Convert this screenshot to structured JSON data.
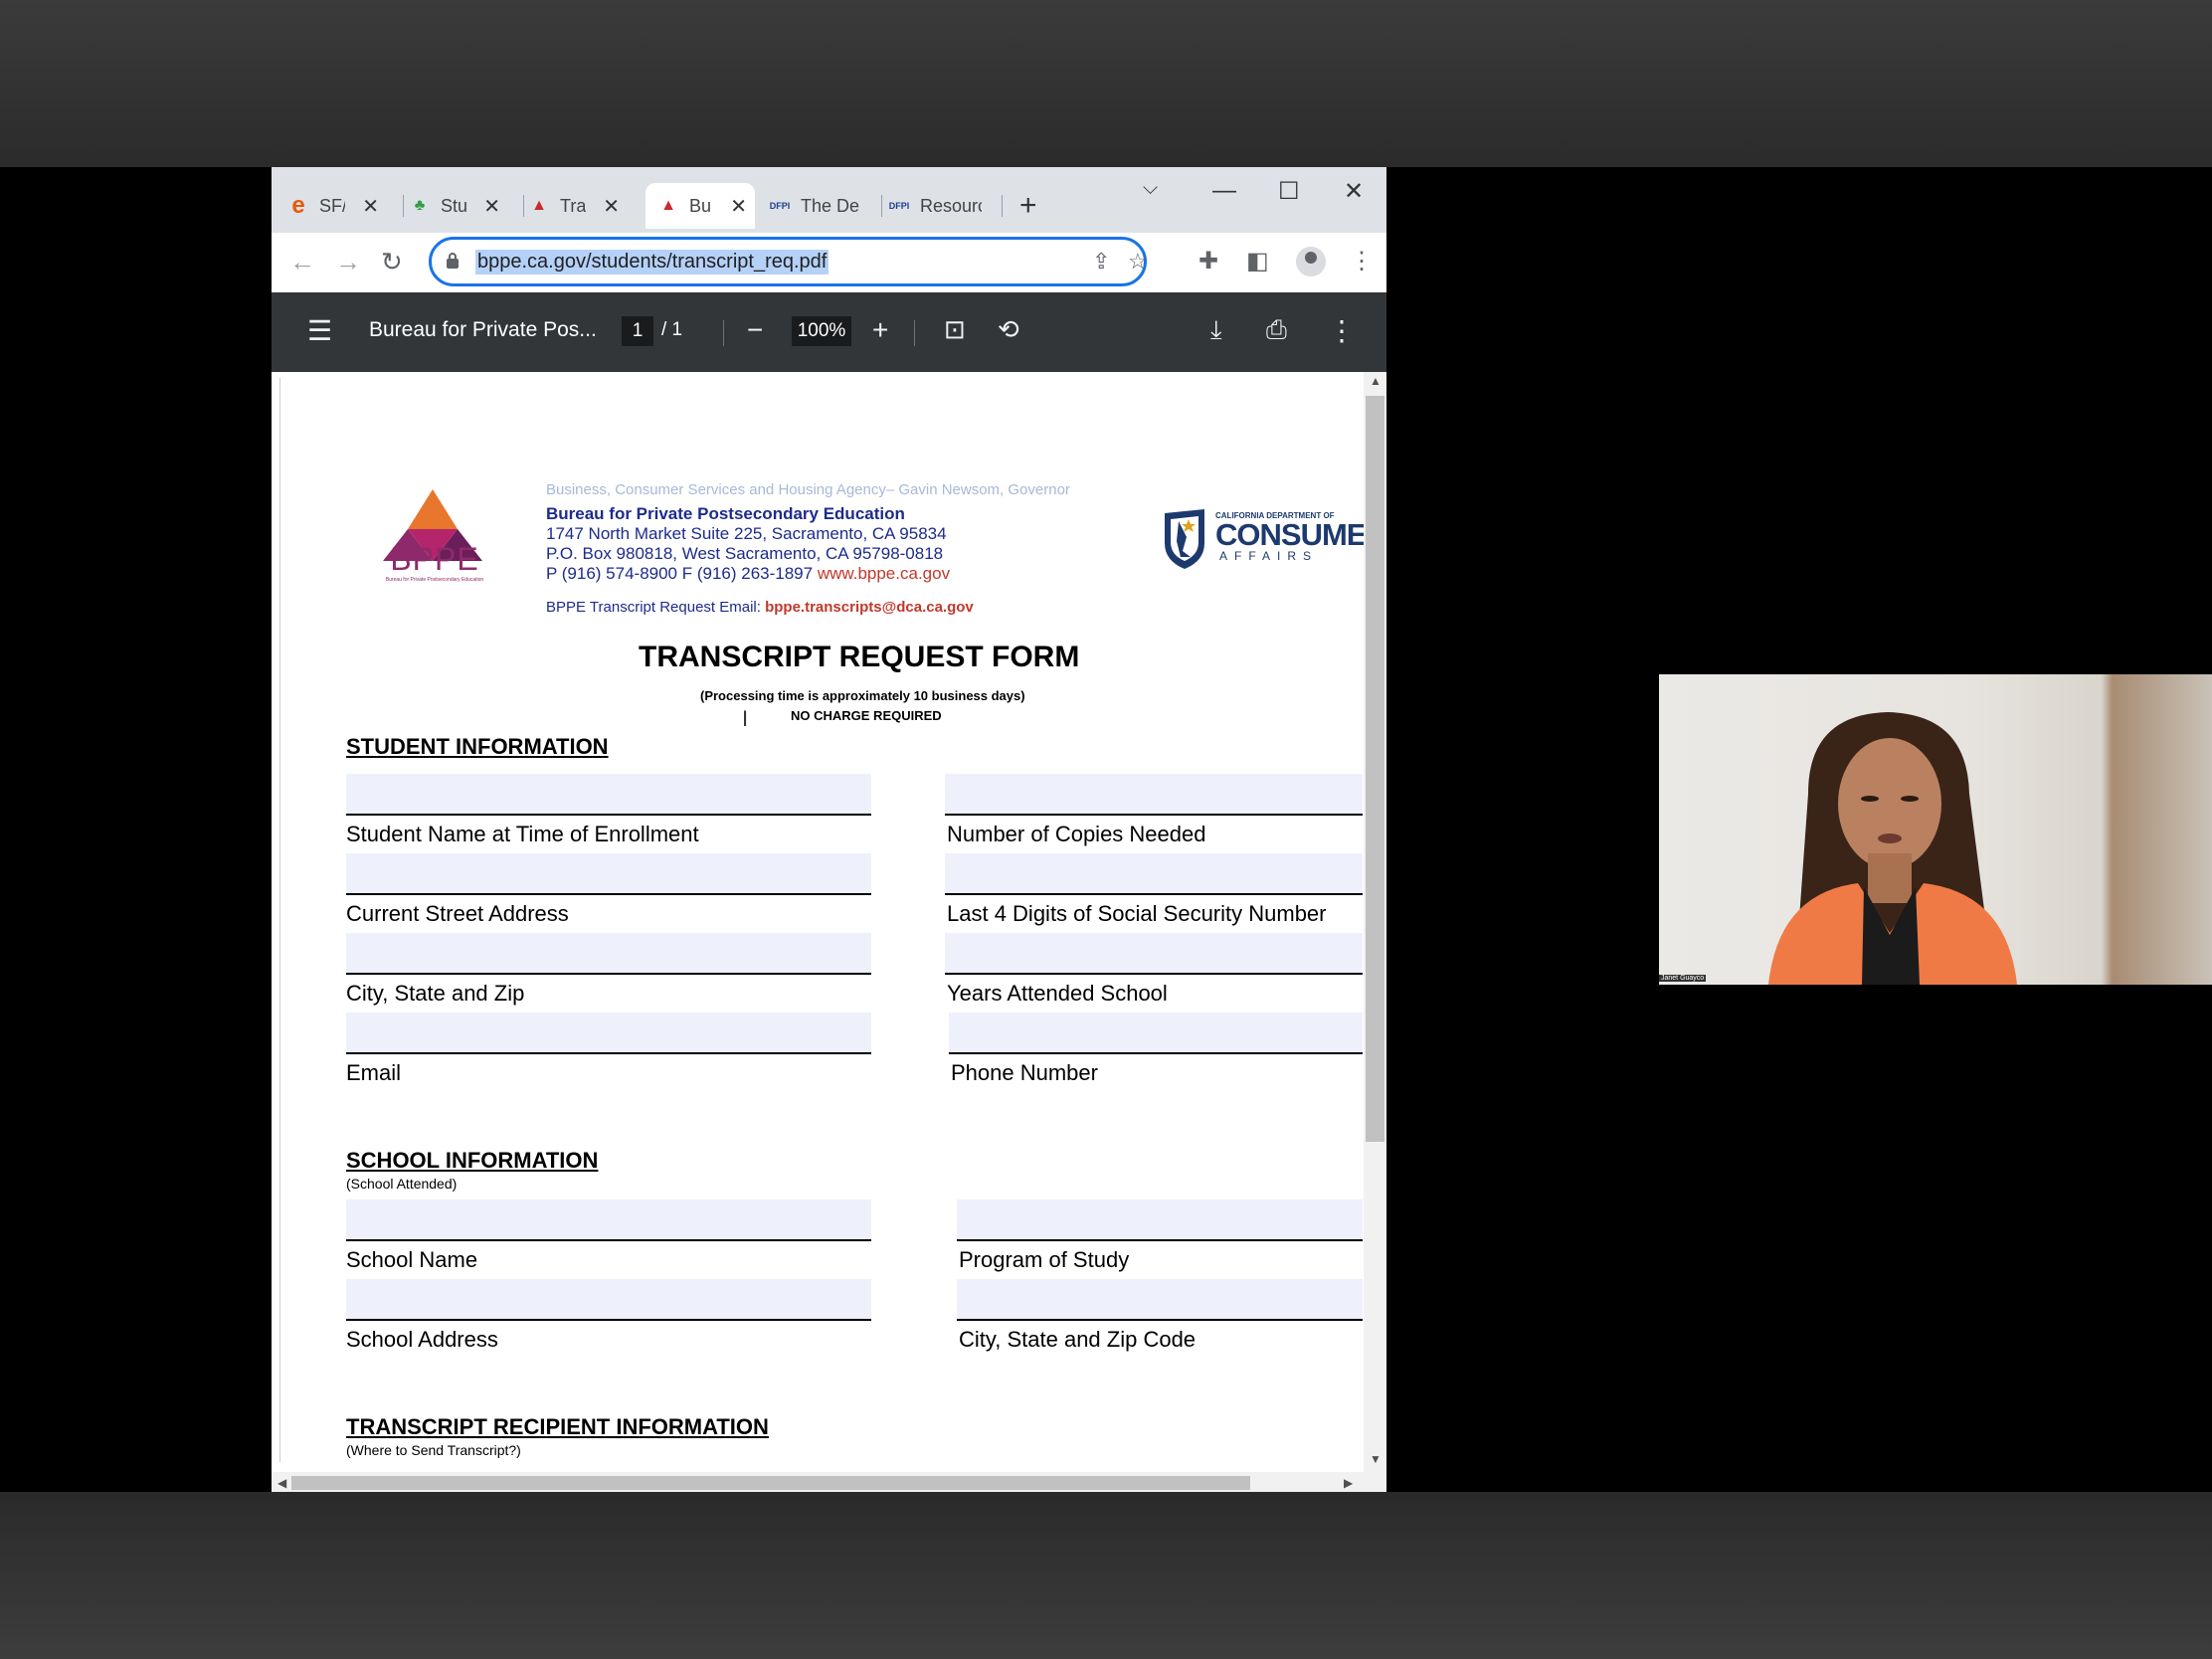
{
  "browser": {
    "tabs": [
      {
        "title": "SF/",
        "icon": "e-icon",
        "color": "#e8590c"
      },
      {
        "title": "Stu",
        "icon": "tree-icon",
        "color": "#2f9e44"
      },
      {
        "title": "Tra",
        "icon": "bppe-icon",
        "color": "#c92a2a"
      },
      {
        "title": "Bu",
        "icon": "bppe-icon",
        "color": "#c92a2a"
      },
      {
        "title": "The De",
        "icon": "dfpi-icon",
        "color": "#1c3f94"
      },
      {
        "title": "Resourc",
        "icon": "dfpi-icon",
        "color": "#1c3f94"
      }
    ],
    "url": "bppe.ca.gov/students/transcript_req.pdf"
  },
  "pdf_viewer": {
    "title": "Bureau for Private Pos...",
    "current_page": "1",
    "total_pages": "/  1",
    "zoom": "100%"
  },
  "document": {
    "agency_line": "Business, Consumer Services and Housing Agency– Gavin Newsom, Governor",
    "bureau_name": "Bureau for Private Postsecondary Education",
    "address_1": "1747 North Market Suite 225, Sacramento, CA 95834",
    "address_2": "P.O. Box 980818, West Sacramento, CA 95798-0818",
    "phone_line": "P (916) 574-8900 F (916) 263-1897",
    "website": "www.bppe.ca.gov",
    "email_label": "BPPE Transcript Request Email:",
    "email_value": "bppe.transcripts@dca.ca.gov",
    "bppe_logo_text": "BPPE",
    "bppe_logo_subtext": "Bureau for Private Postsecondary Education",
    "dca_small": "CALIFORNIA DEPARTMENT OF",
    "dca_big": "CONSUMER",
    "dca_affairs": "AFFAIRS",
    "form_title": "TRANSCRIPT REQUEST FORM",
    "processing_note": "(Processing time is approximately 10 business days)",
    "no_charge": "NO CHARGE REQUIRED",
    "student_section": "STUDENT INFORMATION",
    "student_fields": {
      "name": "Student Name at Time of Enrollment",
      "copies": "Number of Copies Needed",
      "street": "Current Street Address",
      "ssn": "Last 4 Digits of Social Security Number",
      "city": "City, State and Zip",
      "years": "Years Attended School",
      "email": "Email",
      "phone": "Phone Number"
    },
    "school_section": "SCHOOL INFORMATION",
    "school_sub": "(School Attended)",
    "school_fields": {
      "name": "School Name",
      "program": "Program of Study",
      "address": "School Address",
      "city": "City, State and Zip Code"
    },
    "recipient_section": "TRANSCRIPT RECIPIENT INFORMATION",
    "recipient_sub": "(Where to Send Transcript?)"
  },
  "webcam": {
    "name_tag": "Janet Guayco"
  }
}
